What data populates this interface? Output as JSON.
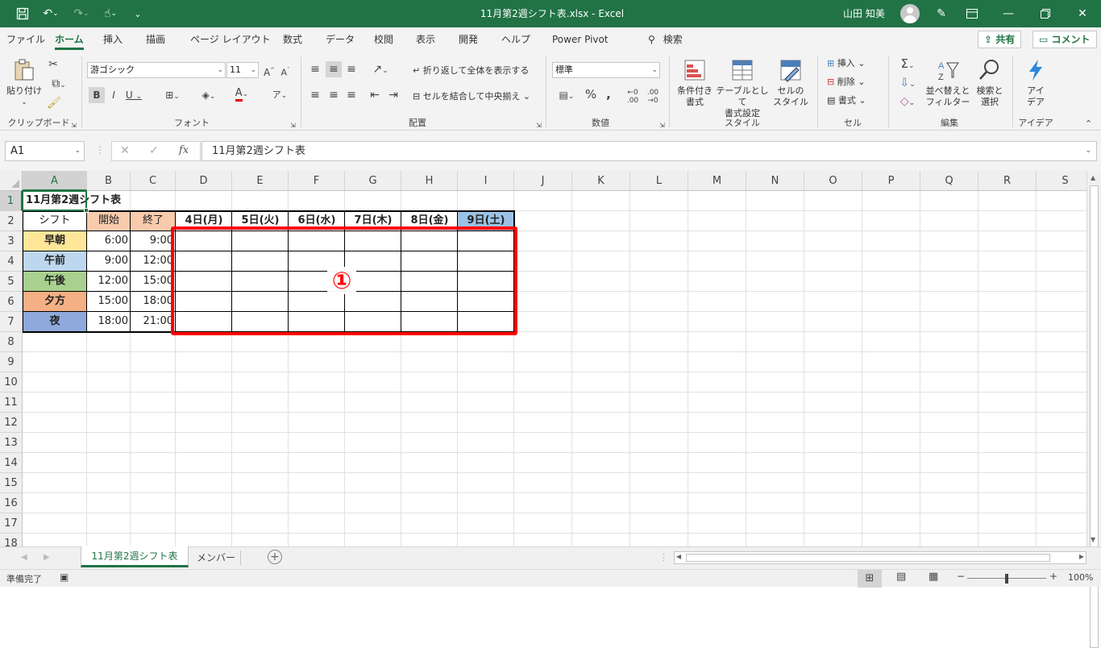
{
  "app": {
    "title": "11月第2週シフト表.xlsx  -  Excel",
    "user": "山田 知美"
  },
  "ribbon_tabs": [
    "ファイル",
    "ホーム",
    "挿入",
    "描画",
    "ページ レイアウト",
    "数式",
    "データ",
    "校閲",
    "表示",
    "開発",
    "ヘルプ",
    "Power Pivot"
  ],
  "search_label": "検索",
  "share_label": "共有",
  "comment_label": "コメント",
  "ribbon": {
    "clipboard": {
      "paste": "貼り付け",
      "label": "クリップボード"
    },
    "font": {
      "name": "游ゴシック",
      "size": "11",
      "label": "フォント"
    },
    "alignment": {
      "wrap": "折り返して全体を表示する",
      "merge": "セルを結合して中央揃え",
      "label": "配置"
    },
    "number": {
      "format": "標準",
      "label": "数値"
    },
    "styles": {
      "conditional": "条件付き\n書式",
      "table": "テーブルとして\n書式設定",
      "cell": "セルの\nスタイル",
      "label": "スタイル"
    },
    "cells": {
      "insert": "挿入",
      "delete": "削除",
      "format": "書式",
      "label": "セル"
    },
    "editing": {
      "sort": "並べ替えと\nフィルター",
      "find": "検索と\n選択",
      "label": "編集"
    },
    "ideas": {
      "button": "アイ\nデア",
      "label": "アイデア"
    }
  },
  "formula_bar": {
    "name_box": "A1",
    "formula": "11月第2週シフト表"
  },
  "columns": [
    "A",
    "B",
    "C",
    "D",
    "E",
    "F",
    "G",
    "H",
    "I",
    "J",
    "K",
    "L",
    "M",
    "N",
    "O",
    "P",
    "Q",
    "R",
    "S"
  ],
  "rows": [
    "1",
    "2",
    "3",
    "4",
    "5",
    "6",
    "7",
    "8",
    "9",
    "10",
    "11",
    "12",
    "13",
    "14",
    "15",
    "16",
    "17",
    "18"
  ],
  "sheet": {
    "title": "11月第2週シフト表",
    "header_shift": "シフト",
    "header_start": "開始",
    "header_end": "終了",
    "days": [
      "4日(月)",
      "5日(火)",
      "6日(水)",
      "7日(木)",
      "8日(金)",
      "9日(土)"
    ],
    "shifts": [
      {
        "name": "早朝",
        "start": "6:00",
        "end": "9:00",
        "color": "#ffe699"
      },
      {
        "name": "午前",
        "start": "9:00",
        "end": "12:00",
        "color": "#bdd7ee"
      },
      {
        "name": "午後",
        "start": "12:00",
        "end": "15:00",
        "color": "#a9d08e"
      },
      {
        "name": "夕方",
        "start": "15:00",
        "end": "18:00",
        "color": "#f4b084"
      },
      {
        "name": "夜",
        "start": "18:00",
        "end": "21:00",
        "color": "#8ea9db"
      }
    ],
    "start_end_header_color": "#f8cbad",
    "saturday_color": "#9bc2e6"
  },
  "annotation": {
    "label": "①",
    "color": "#ff0000"
  },
  "sheet_tabs": [
    "11月第2週シフト表",
    "メンバー"
  ],
  "status": {
    "ready": "準備完了",
    "zoom": "100%"
  },
  "colors": {
    "excel_green": "#217346"
  }
}
